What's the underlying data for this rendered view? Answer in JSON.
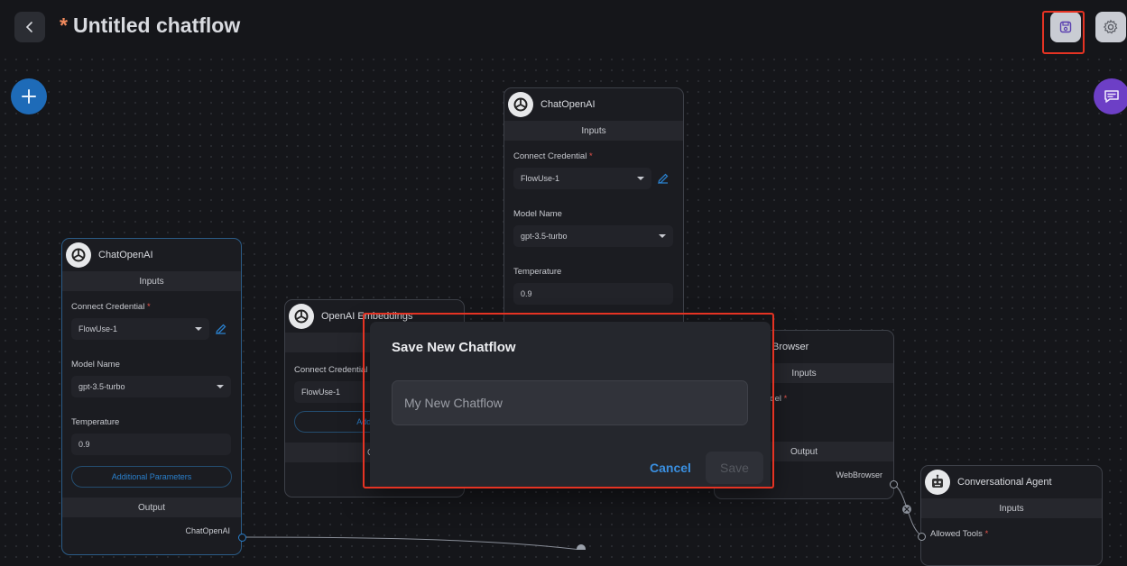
{
  "header": {
    "title_prefix": "*",
    "title": "Untitled chatflow"
  },
  "nodes": {
    "chat_left": {
      "name": "ChatOpenAI",
      "inputs_label": "Inputs",
      "credential_label": "Connect Credential",
      "credential_value": "FlowUse-1",
      "model_label": "Model Name",
      "model_value": "gpt-3.5-turbo",
      "temperature_label": "Temperature",
      "temperature_value": "0.9",
      "additional_label": "Additional Parameters",
      "output_label": "Output",
      "output_value": "ChatOpenAI"
    },
    "chat_top": {
      "name": "ChatOpenAI",
      "inputs_label": "Inputs",
      "credential_label": "Connect Credential",
      "credential_value": "FlowUse-1",
      "model_label": "Model Name",
      "model_value": "gpt-3.5-turbo",
      "temperature_label": "Temperature",
      "temperature_value": "0.9"
    },
    "embeddings": {
      "name": "OpenAI Embeddings",
      "inputs_label": "In",
      "credential_label": "Connect Credential",
      "credential_value": "FlowUse-1",
      "additional_label": "Additional",
      "output_label": "Out"
    },
    "browser": {
      "name": "Browser",
      "inputs_label": "Inputs",
      "model_label": "odel",
      "output_label": "Output",
      "output_value": "WebBrowser"
    },
    "agent": {
      "name": "Conversational Agent",
      "inputs_label": "Inputs",
      "tools_label": "Allowed Tools"
    }
  },
  "dialog": {
    "title": "Save New Chatflow",
    "input_placeholder": "My New Chatflow",
    "input_value": "",
    "cancel_label": "Cancel",
    "save_label": "Save"
  },
  "colors": {
    "accent": "#3a8fe0",
    "highlight": "#e53323",
    "fab_add": "#1e6bb8",
    "fab_chat": "#6d3fc6"
  }
}
